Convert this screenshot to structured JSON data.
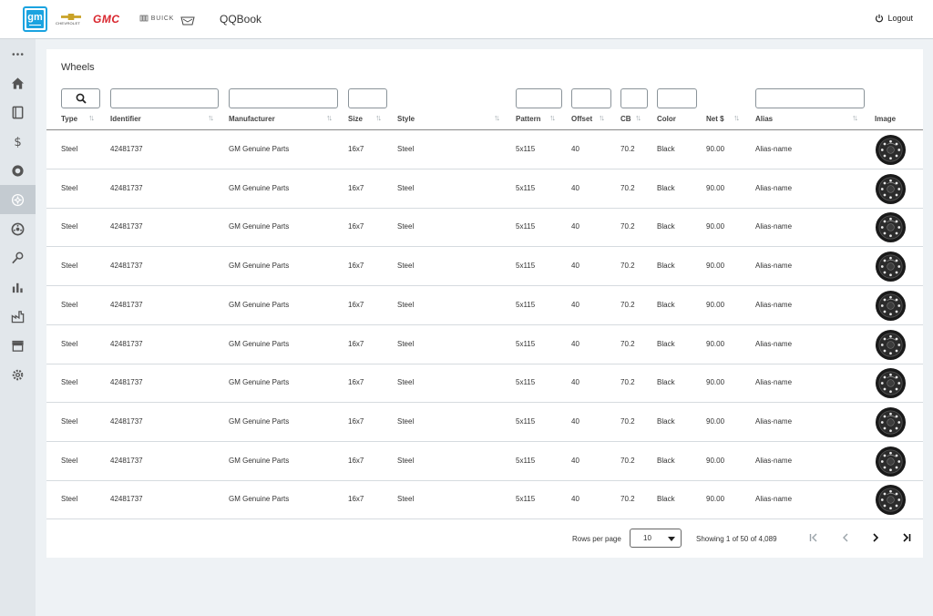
{
  "header": {
    "app_title": "QQBook",
    "logout_label": "Logout",
    "logo_text": "gm",
    "brands": {
      "chevrolet": "CHEVROLET",
      "gmc": "GMC",
      "buick": "BUICK"
    }
  },
  "sidebar": {
    "items": [
      {
        "name": "more-icon",
        "active": false
      },
      {
        "name": "home-icon",
        "active": false
      },
      {
        "name": "book-icon",
        "active": false
      },
      {
        "name": "dollar-icon",
        "active": false
      },
      {
        "name": "tire-icon",
        "active": false
      },
      {
        "name": "wheel-icon",
        "active": true
      },
      {
        "name": "rim-icon",
        "active": false
      },
      {
        "name": "tools-icon",
        "active": false
      },
      {
        "name": "chart-icon",
        "active": false
      },
      {
        "name": "factory-icon",
        "active": false
      },
      {
        "name": "store-icon",
        "active": false
      },
      {
        "name": "settings-icon",
        "active": false
      }
    ]
  },
  "page": {
    "title": "Wheels"
  },
  "table": {
    "columns": [
      "Type",
      "Identifier",
      "Manufacturer",
      "Size",
      "Style",
      "Pattern",
      "Offset",
      "CB",
      "Color",
      "Net $",
      "Alias",
      "Image"
    ],
    "rows": [
      [
        "Steel",
        "42481737",
        "GM Genuine Parts",
        "16x7",
        "Steel",
        "5x115",
        "40",
        "70.2",
        "Black",
        "90.00",
        "Alias-name"
      ],
      [
        "Steel",
        "42481737",
        "GM Genuine Parts",
        "16x7",
        "Steel",
        "5x115",
        "40",
        "70.2",
        "Black",
        "90.00",
        "Alias-name"
      ],
      [
        "Steel",
        "42481737",
        "GM Genuine Parts",
        "16x7",
        "Steel",
        "5x115",
        "40",
        "70.2",
        "Black",
        "90.00",
        "Alias-name"
      ],
      [
        "Steel",
        "42481737",
        "GM Genuine Parts",
        "16x7",
        "Steel",
        "5x115",
        "40",
        "70.2",
        "Black",
        "90.00",
        "Alias-name"
      ],
      [
        "Steel",
        "42481737",
        "GM Genuine Parts",
        "16x7",
        "Steel",
        "5x115",
        "40",
        "70.2",
        "Black",
        "90.00",
        "Alias-name"
      ],
      [
        "Steel",
        "42481737",
        "GM Genuine Parts",
        "16x7",
        "Steel",
        "5x115",
        "40",
        "70.2",
        "Black",
        "90.00",
        "Alias-name"
      ],
      [
        "Steel",
        "42481737",
        "GM Genuine Parts",
        "16x7",
        "Steel",
        "5x115",
        "40",
        "70.2",
        "Black",
        "90.00",
        "Alias-name"
      ],
      [
        "Steel",
        "42481737",
        "GM Genuine Parts",
        "16x7",
        "Steel",
        "5x115",
        "40",
        "70.2",
        "Black",
        "90.00",
        "Alias-name"
      ],
      [
        "Steel",
        "42481737",
        "GM Genuine Parts",
        "16x7",
        "Steel",
        "5x115",
        "40",
        "70.2",
        "Black",
        "90.00",
        "Alias-name"
      ],
      [
        "Steel",
        "42481737",
        "GM Genuine Parts",
        "16x7",
        "Steel",
        "5x115",
        "40",
        "70.2",
        "Black",
        "90.00",
        "Alias-name"
      ]
    ]
  },
  "pagination": {
    "rows_per_page_label": "Rows per page",
    "rows_per_page_value": "10",
    "showing_text": "Showing 1 of 50 of 4,089"
  },
  "colors": {
    "accent": "#1aa3e0",
    "gmc_red": "#d9262e",
    "sidebar_active": "#c4cbd1"
  }
}
